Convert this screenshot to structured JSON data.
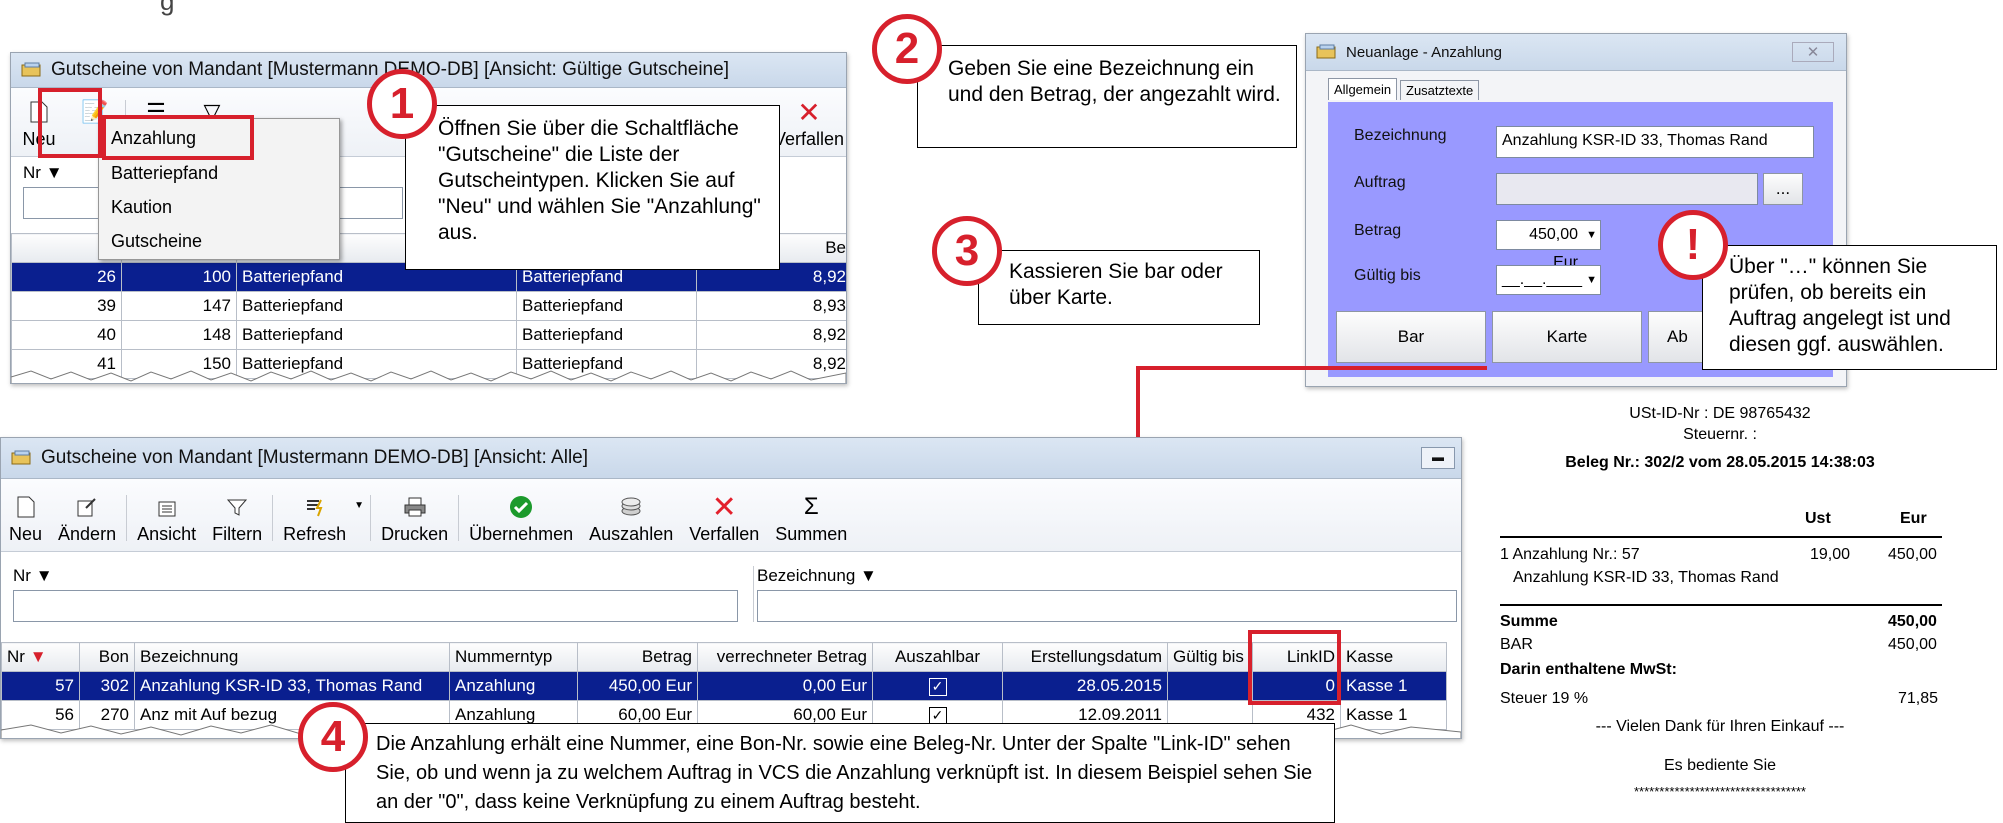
{
  "top_window": {
    "title": "Gutscheine von Mandant [Mustermann DEMO-DB] [Ansicht: Gültige Gutscheine]",
    "new_label": "Neu",
    "filter_label": "Nr",
    "toolbar_right_label": "Verfallen",
    "col_nr": "Nr",
    "col_cut": "Be",
    "menu": [
      "Anzahlung",
      "Batteriepfand",
      "Kaution",
      "Gutscheine"
    ],
    "rows": [
      {
        "nr": "26",
        "bon": "100",
        "bez": "Batteriepfand",
        "typ": "Batteriepfand",
        "betrag": "8,92"
      },
      {
        "nr": "39",
        "bon": "147",
        "bez": "Batteriepfand",
        "typ": "Batteriepfand",
        "betrag": "8,93"
      },
      {
        "nr": "40",
        "bon": "148",
        "bez": "Batteriepfand",
        "typ": "Batteriepfand",
        "betrag": "8,92"
      },
      {
        "nr": "41",
        "bon": "150",
        "bez": "Batteriepfand",
        "typ": "Batteriepfand",
        "betrag": "8,92"
      }
    ]
  },
  "callouts": {
    "c1_num": "1",
    "c1": "Öffnen Sie über die Schaltfläche \"Gutscheine\" die Liste der Gutscheintypen. Klicken Sie auf \"Neu\" und wählen Sie \"Anzahlung\" aus.",
    "c2_num": "2",
    "c2": "Geben Sie eine Bezeichnung ein und den Betrag, der angezahlt wird.",
    "c3_num": "3",
    "c3": "Kassieren Sie bar oder über Karte.",
    "c_excl": "!",
    "c_excl_text": "Über \"…\" können Sie prüfen, ob bereits ein Auftrag angelegt ist und diesen ggf. auswählen.",
    "c4_num": "4",
    "c4": "Die Anzahlung erhält eine Nummer, eine Bon-Nr. sowie eine Beleg-Nr. Unter der Spalte \"Link-ID\" sehen Sie, ob und wenn ja zu welchem Auftrag in VCS die Anzahlung verknüpft ist. In diesem Beispiel sehen Sie an der \"0\", dass keine Verknüpfung zu einem Auftrag besteht."
  },
  "dialog": {
    "title": "Neuanlage - Anzahlung",
    "tab1": "Allgemein",
    "tab2": "Zusatztexte",
    "lbl_bez": "Bezeichnung",
    "val_bez": "Anzahlung KSR-ID 33, Thomas Rand",
    "lbl_auftrag": "Auftrag",
    "dots": "...",
    "lbl_betrag": "Betrag",
    "val_betrag": "450,00 Eur",
    "lbl_gueltig": "Gültig bis",
    "val_gueltig": "__.__.____",
    "btn_bar": "Bar",
    "btn_karte": "Karte",
    "btn_ab": "Ab"
  },
  "main_window": {
    "title": "Gutscheine von Mandant [Mustermann DEMO-DB] [Ansicht: Alle]",
    "toolbar": [
      {
        "icon": "new-icon",
        "label": "Neu"
      },
      {
        "icon": "edit-icon",
        "label": "Ändern"
      },
      {
        "icon": "view-icon",
        "label": "Ansicht"
      },
      {
        "icon": "filter-icon",
        "label": "Filtern"
      },
      {
        "icon": "refresh-icon",
        "label": "Refresh"
      },
      {
        "icon": "print-icon",
        "label": "Drucken"
      },
      {
        "icon": "accept-icon",
        "label": "Übernehmen"
      },
      {
        "icon": "payout-icon",
        "label": "Auszahlen"
      },
      {
        "icon": "expire-icon",
        "label": "Verfallen"
      },
      {
        "icon": "sum-icon",
        "label": "Summen"
      }
    ],
    "filter_nr": "Nr",
    "filter_bez": "Bezeichnung",
    "columns": [
      "Nr",
      "Bon",
      "Bezeichnung",
      "Nummerntyp",
      "Betrag",
      "verrechneter Betrag",
      "Auszahlbar",
      "Erstellungsdatum",
      "Gültig bis",
      "LinkID",
      "Kasse"
    ],
    "rows": [
      {
        "nr": "57",
        "bon": "302",
        "bez": "Anzahlung KSR-ID 33, Thomas Rand",
        "typ": "Anzahlung",
        "betrag": "450,00 Eur",
        "verr": "0,00 Eur",
        "aus": "✓",
        "datum": "28.05.2015",
        "gueltig": "",
        "link": "0",
        "kasse": "Kasse 1"
      },
      {
        "nr": "56",
        "bon": "270",
        "bez": "Anz mit Auf bezug",
        "typ": "Anzahlung",
        "betrag": "60,00 Eur",
        "verr": "60,00 Eur",
        "aus": "✓",
        "datum": "12.09.2011",
        "gueltig": "",
        "link": "432",
        "kasse": "Kasse 1"
      }
    ]
  },
  "receipt": {
    "ust_id": "USt-ID-Nr : DE 98765432",
    "steuernr": "Steuernr. :",
    "beleg": "Beleg Nr.: 302/2 vom 28.05.2015  14:38:03",
    "hdr_ust": "Ust",
    "hdr_eur": "Eur",
    "item_line": "1 Anzahlung Nr.: 57",
    "item_ust": "19,00",
    "item_eur": "450,00",
    "item_sub": "Anzahlung KSR-ID 33, Thomas Rand",
    "summe": "Summe",
    "summe_val": "450,00",
    "bar": "BAR",
    "bar_val": "450,00",
    "mwst": "Darin enthaltene MwSt:",
    "steuer": "Steuer 19 %",
    "steuer_val": "71,85",
    "danke": "--- Vielen Dank für Ihren Einkauf ---",
    "bediente": "Es bediente Sie",
    "stars": "**********************************"
  },
  "colors": {
    "accent": "#d7202c",
    "selection": "#0a1f8f",
    "dialog_panel": "#9999ff"
  }
}
